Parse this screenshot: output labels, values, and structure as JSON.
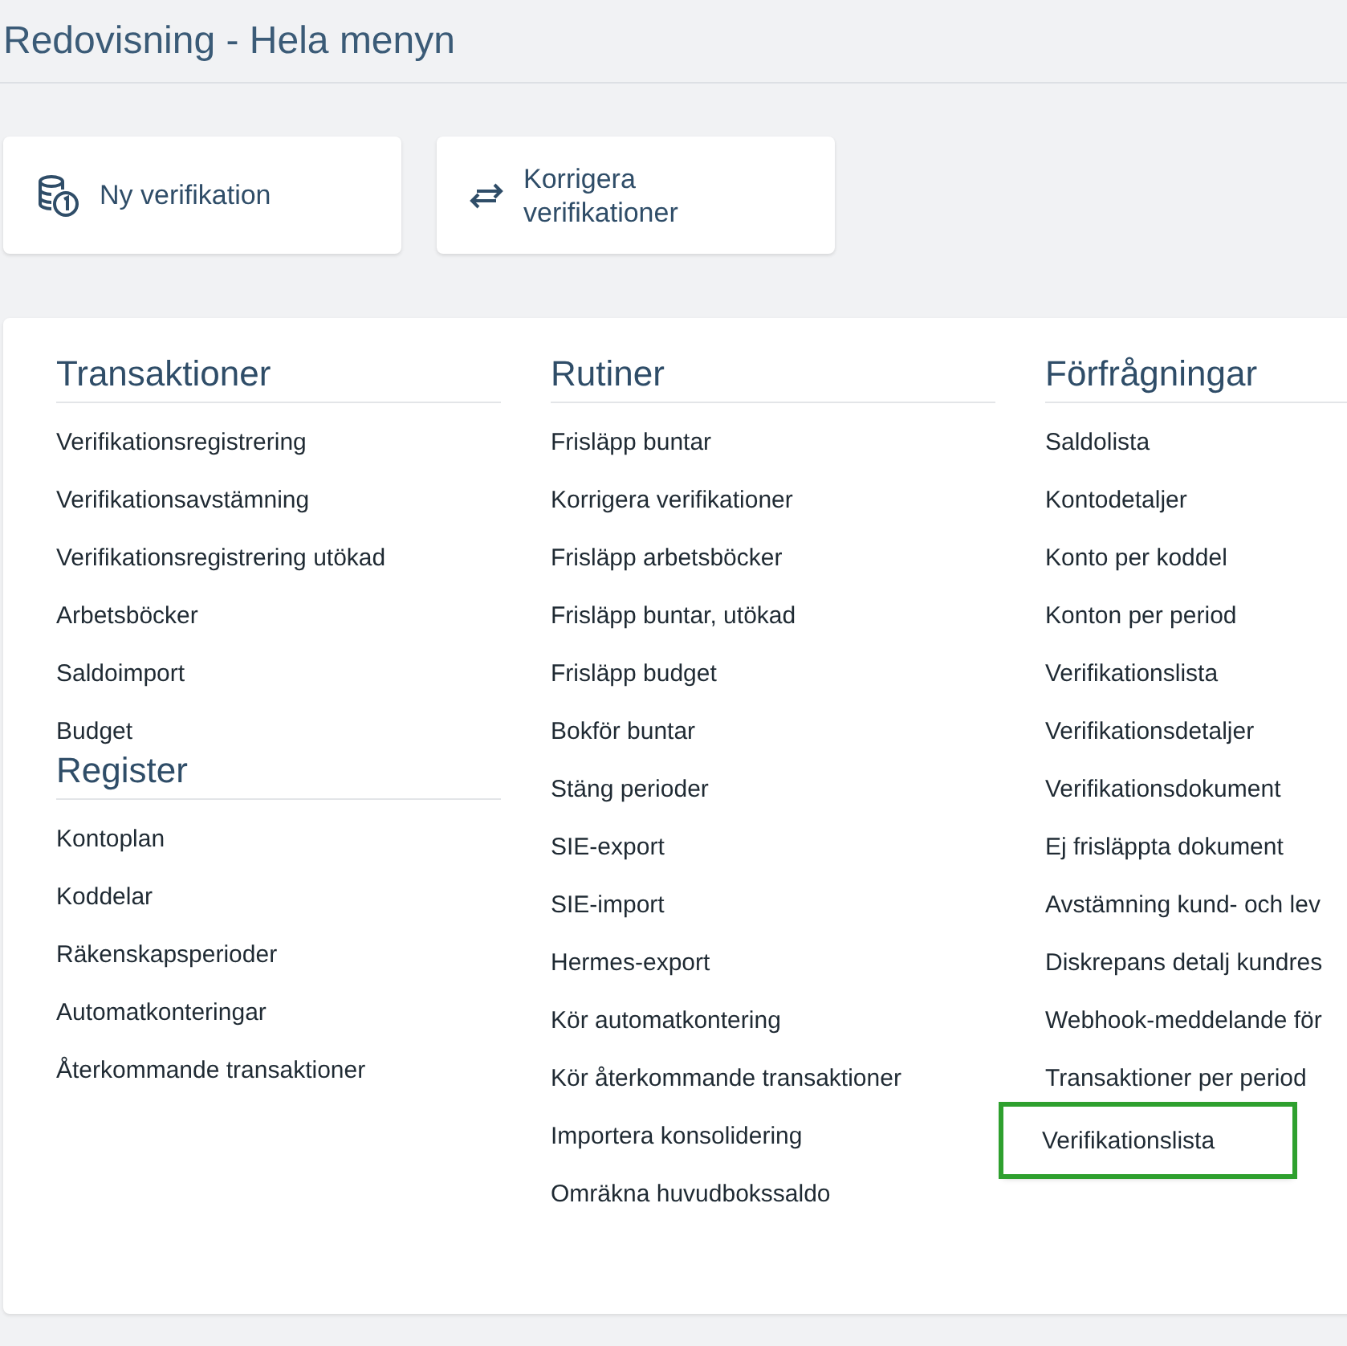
{
  "page": {
    "title": "Redovisning - Hela menyn"
  },
  "quick_actions": [
    {
      "kind": "coins",
      "label": "Ny verifikation"
    },
    {
      "kind": "swap",
      "label": "Korrigera verifikationer"
    }
  ],
  "columns": [
    {
      "groups": [
        {
          "title": "Transaktioner",
          "items": [
            {
              "label": "Verifikationsregistrering",
              "selected": false
            },
            {
              "label": "Verifikationsavstämning",
              "selected": false
            },
            {
              "label": "Verifikationsregistrering utökad",
              "selected": false
            },
            {
              "label": "Arbetsböcker",
              "selected": false
            },
            {
              "label": "Saldoimport",
              "selected": false
            },
            {
              "label": "Budget",
              "selected": false
            }
          ]
        },
        {
          "title": "Register",
          "items": [
            {
              "label": "Kontoplan",
              "selected": false
            },
            {
              "label": "Koddelar",
              "selected": false
            },
            {
              "label": "Räkenskapsperioder",
              "selected": false
            },
            {
              "label": "Automatkonteringar",
              "selected": false
            },
            {
              "label": "Återkommande transaktioner",
              "selected": false
            }
          ]
        }
      ]
    },
    {
      "groups": [
        {
          "title": "Rutiner",
          "items": [
            {
              "label": "Frisläpp buntar",
              "selected": false
            },
            {
              "label": "Korrigera verifikationer",
              "selected": false
            },
            {
              "label": "Frisläpp arbetsböcker",
              "selected": false
            },
            {
              "label": "Frisläpp buntar, utökad",
              "selected": false
            },
            {
              "label": "Frisläpp budget",
              "selected": false
            },
            {
              "label": "Bokför buntar",
              "selected": false
            },
            {
              "label": "Stäng perioder",
              "selected": false
            },
            {
              "label": "SIE-export",
              "selected": false
            },
            {
              "label": "SIE-import",
              "selected": false
            },
            {
              "label": "Hermes-export",
              "selected": false
            },
            {
              "label": "Kör automatkontering",
              "selected": false
            },
            {
              "label": "Kör återkommande transaktioner",
              "selected": false
            },
            {
              "label": "Importera konsolidering",
              "selected": false
            },
            {
              "label": "Omräkna huvudbokssaldo",
              "selected": false
            }
          ]
        }
      ]
    },
    {
      "groups": [
        {
          "title": "Förfrågningar",
          "items": [
            {
              "label": "Saldolista",
              "selected": false
            },
            {
              "label": "Kontodetaljer",
              "selected": false
            },
            {
              "label": "Konto per koddel",
              "selected": false
            },
            {
              "label": "Konton per period",
              "selected": false
            },
            {
              "label": "Verifikationslista",
              "selected": false
            },
            {
              "label": "Verifikationsdetaljer",
              "selected": false
            },
            {
              "label": "Verifikationsdokument",
              "selected": false
            },
            {
              "label": "Ej frisläppta dokument",
              "selected": false
            },
            {
              "label": "Avstämning kund- och lev",
              "selected": false
            },
            {
              "label": "Diskrepans detalj kundres",
              "selected": false
            },
            {
              "label": "Webhook-meddelande för",
              "selected": false
            },
            {
              "label": "Transaktioner per period",
              "selected": false
            },
            {
              "label": "Verifikationslista",
              "selected": true
            }
          ]
        }
      ]
    }
  ]
}
